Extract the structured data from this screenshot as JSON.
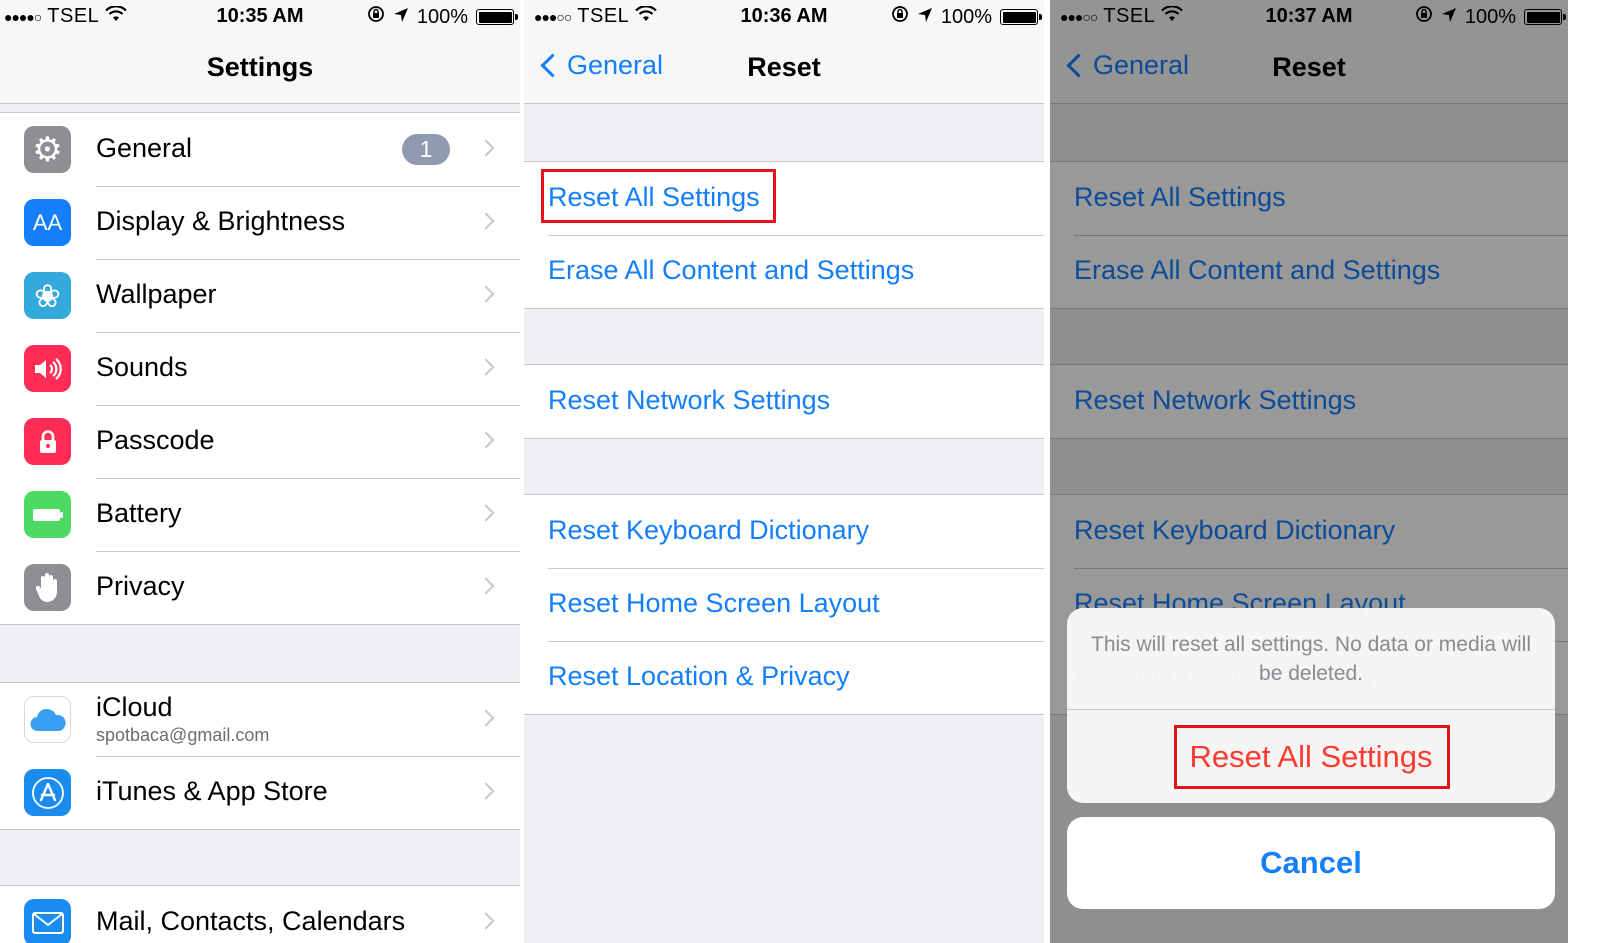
{
  "status_bars": [
    {
      "signal": "●●●●○",
      "carrier": "TSEL",
      "time": "10:35 AM",
      "battery": "100%"
    },
    {
      "signal": "●●●○○",
      "carrier": "TSEL",
      "time": "10:36 AM",
      "battery": "100%"
    },
    {
      "signal": "●●●○○",
      "carrier": "TSEL",
      "time": "10:37 AM",
      "battery": "100%"
    }
  ],
  "settings": {
    "title": "Settings",
    "group1": [
      {
        "label": "General",
        "icon": "gear-icon",
        "icon_glyph": "⚙",
        "color": "#8e8e93",
        "badge": "1"
      },
      {
        "label": "Display & Brightness",
        "icon": "text-size-icon",
        "icon_glyph": "AA",
        "color": "#147efb"
      },
      {
        "label": "Wallpaper",
        "icon": "flower-icon",
        "icon_glyph": "❀",
        "color": "#34aadc"
      },
      {
        "label": "Sounds",
        "icon": "speaker-icon",
        "icon_glyph": "🔊",
        "color": "#ff2d55"
      },
      {
        "label": "Passcode",
        "icon": "lock-icon",
        "icon_glyph": "🔒",
        "color": "#ff2d55"
      },
      {
        "label": "Battery",
        "icon": "battery-icon",
        "icon_glyph": "▭",
        "color": "#4cd964"
      },
      {
        "label": "Privacy",
        "icon": "hand-icon",
        "icon_glyph": "✋",
        "color": "#8e8e93"
      }
    ],
    "group2": [
      {
        "label": "iCloud",
        "sublabel": "spotbaca@gmail.com",
        "icon": "cloud-icon",
        "icon_glyph": "☁",
        "color": "#ffffff"
      },
      {
        "label": "iTunes & App Store",
        "icon": "app-store-icon",
        "icon_glyph": "A",
        "color": "#1a8cf0"
      }
    ],
    "group3": [
      {
        "label": "Mail, Contacts, Calendars",
        "icon": "mail-icon",
        "icon_glyph": "✉",
        "color": "#1a8cf0"
      }
    ]
  },
  "reset": {
    "back_label": "General",
    "title": "Reset",
    "items": [
      "Reset All Settings",
      "Erase All Content and Settings",
      "Reset Network Settings",
      "Reset Keyboard Dictionary",
      "Reset Home Screen Layout",
      "Reset Location & Privacy"
    ]
  },
  "action_sheet": {
    "message": "This will reset all settings. No data or media will be deleted.",
    "action": "Reset All Settings",
    "cancel": "Cancel"
  },
  "colors": {
    "accent": "#147efb",
    "destructive": "#ff3b30",
    "highlight": "#e3121b"
  }
}
